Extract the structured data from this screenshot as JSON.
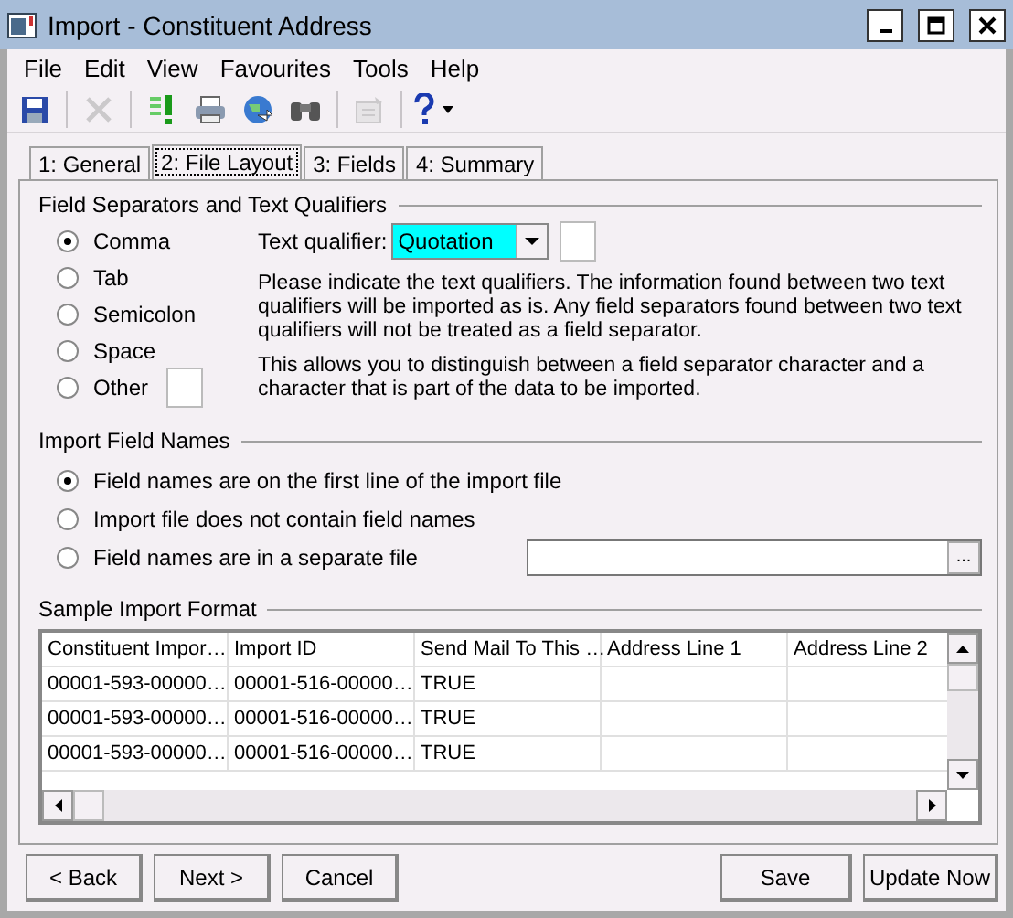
{
  "window": {
    "title": "Import - Constituent Address"
  },
  "menu": [
    "File",
    "Edit",
    "View",
    "Favourites",
    "Tools",
    "Help"
  ],
  "toolbar": [
    {
      "kind": "save",
      "disabled": false
    },
    {
      "kind": "delete",
      "disabled": true
    },
    {
      "kind": "run",
      "disabled": false
    },
    {
      "kind": "print",
      "disabled": false
    },
    {
      "kind": "globe",
      "disabled": false
    },
    {
      "kind": "find",
      "disabled": false
    },
    {
      "kind": "properties",
      "disabled": true
    },
    {
      "kind": "help",
      "disabled": false
    }
  ],
  "tabs": [
    {
      "label": "1: General",
      "selected": false
    },
    {
      "label": "2: File Layout",
      "selected": true
    },
    {
      "label": "3: Fields",
      "selected": false
    },
    {
      "label": "4: Summary",
      "selected": false
    }
  ],
  "separators": {
    "title": "Field Separators and Text Qualifiers",
    "options": [
      {
        "label": "Comma",
        "selected": true,
        "kind": "plain"
      },
      {
        "label": "Tab",
        "selected": false,
        "kind": "plain"
      },
      {
        "label": "Semicolon",
        "selected": false,
        "kind": "plain"
      },
      {
        "label": "Space",
        "selected": false,
        "kind": "plain"
      },
      {
        "label": "Other",
        "selected": false,
        "kind": "field"
      }
    ],
    "qualifier": {
      "label": "Text qualifier:",
      "value": "Quotation"
    },
    "notes": [
      "Please indicate the text qualifiers.  The information found between two text qualifiers will be imported as is.  Any field separators found between two text qualifiers will not be treated as a field separator.",
      "This allows you to distinguish between a field separator character and a character that is part of the data to be imported."
    ]
  },
  "field_names": {
    "title": "Import Field Names",
    "options": [
      {
        "label": "Field names are on the first line of the import file",
        "selected": true,
        "kind": "plain"
      },
      {
        "label": "Import file does not contain field names",
        "selected": false,
        "kind": "plain"
      },
      {
        "label": "Field names are in a separate file",
        "selected": false,
        "kind": "file"
      }
    ],
    "browse": "..."
  },
  "sample": {
    "title": "Sample Import Format",
    "columns": [
      "Constituent Impor…",
      "Import ID",
      "Send Mail To This …",
      "Address Line 1",
      "Address Line 2"
    ],
    "rows": [
      [
        "00001-593-00000…",
        "00001-516-00000…",
        "TRUE",
        "",
        ""
      ],
      [
        "00001-593-00000…",
        "00001-516-00000…",
        "TRUE",
        "",
        ""
      ],
      [
        "00001-593-00000…",
        "00001-516-00000…",
        "TRUE",
        "",
        ""
      ]
    ]
  },
  "buttons": {
    "left": [
      "< Back",
      "Next >",
      "Cancel"
    ],
    "right": [
      "Save",
      "Update Now"
    ]
  }
}
